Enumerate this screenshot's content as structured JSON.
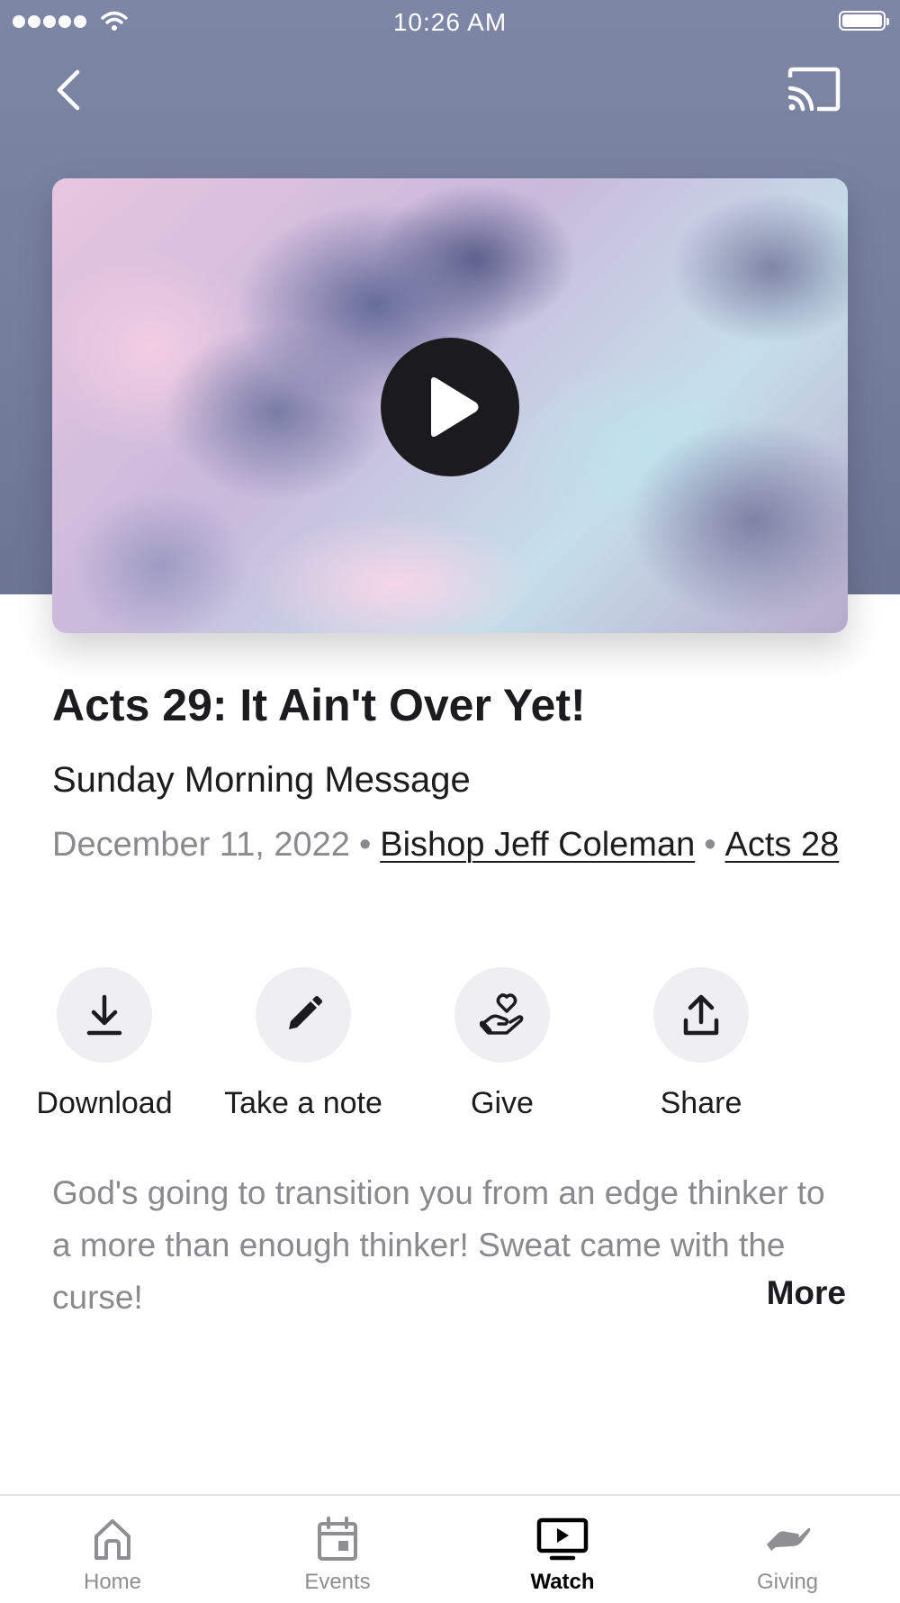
{
  "status_bar": {
    "time": "10:26 AM",
    "signal_icon": "signal-dots-icon",
    "wifi_icon": "wifi-icon",
    "battery_icon": "battery-icon",
    "battery_level": 1.0
  },
  "navigation": {
    "back_icon": "chevron-left-icon",
    "cast_icon": "cast-icon"
  },
  "video": {
    "play_icon": "play-icon"
  },
  "sermon": {
    "title": "Acts 29: It Ain't Over Yet!",
    "subtitle": "Sunday Morning Message",
    "date": "December 11, 2022",
    "separator": "•",
    "speaker": "Bishop Jeff Coleman",
    "scripture": "Acts 28"
  },
  "actions": [
    {
      "label": "Download",
      "icon": "download-icon"
    },
    {
      "label": "Take a note",
      "icon": "pencil-icon"
    },
    {
      "label": "Give",
      "icon": "hand-heart-icon"
    },
    {
      "label": "Share",
      "icon": "share-icon"
    }
  ],
  "description": {
    "text": "God's going to transition you from an edge thinker to a more than enough thinker! Sweat came with the curse!",
    "more_label": "More"
  },
  "tabbar": {
    "items": [
      {
        "label": "Home",
        "icon": "home-icon",
        "active": false
      },
      {
        "label": "Events",
        "icon": "calendar-icon",
        "active": false
      },
      {
        "label": "Watch",
        "icon": "tv-play-icon",
        "active": true
      },
      {
        "label": "Giving",
        "icon": "giving-hand-icon",
        "active": false
      }
    ]
  },
  "colors": {
    "header_background": "#7a82a2",
    "play_button": "#1b1b1f",
    "action_circle": "#efeff1",
    "secondary_text": "#8a8a8e",
    "primary_text": "#1c1c1e",
    "tab_inactive": "#8e8e93",
    "tab_active": "#000000"
  }
}
